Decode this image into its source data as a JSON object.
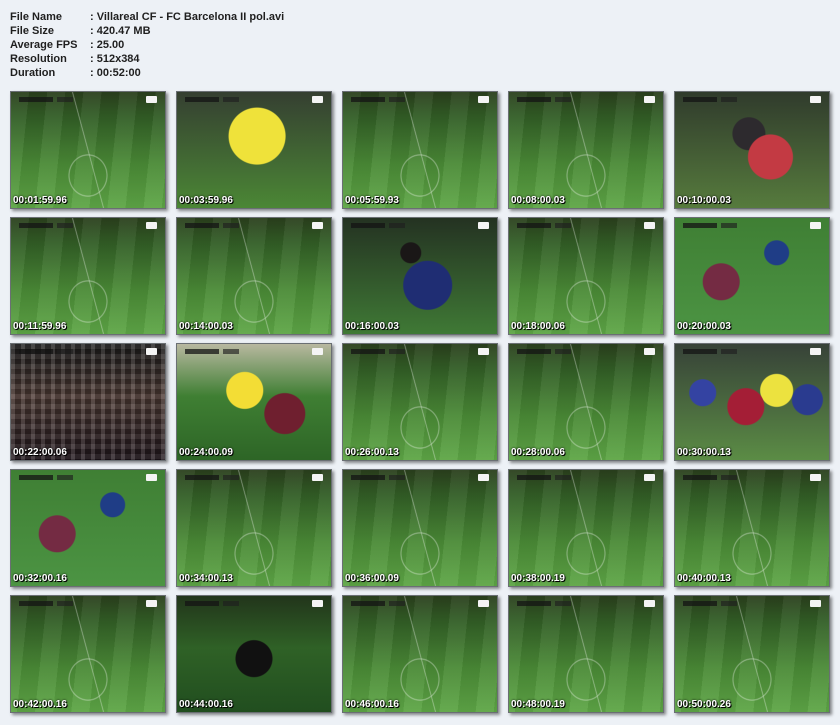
{
  "file_info": [
    {
      "label": "File Name",
      "value": ": Villareal CF - FC Barcelona II pol.avi"
    },
    {
      "label": "File Size",
      "value": ": 420.47 MB"
    },
    {
      "label": "Average FPS",
      "value": ": 25.00"
    },
    {
      "label": "Resolution",
      "value": ": 512x384"
    },
    {
      "label": "Duration",
      "value": ": 00:52:00"
    }
  ],
  "thumbnails": [
    {
      "time": "00:01:59.96",
      "kind": "field"
    },
    {
      "time": "00:03:59.96",
      "kind": "yellowplay"
    },
    {
      "time": "00:05:59.93",
      "kind": "field"
    },
    {
      "time": "00:08:00.03",
      "kind": "field"
    },
    {
      "time": "00:10:00.03",
      "kind": "close"
    },
    {
      "time": "00:11:59.96",
      "kind": "field"
    },
    {
      "time": "00:14:00.03",
      "kind": "field"
    },
    {
      "time": "00:16:00.03",
      "kind": "blueplayer"
    },
    {
      "time": "00:18:00.06",
      "kind": "field"
    },
    {
      "time": "00:20:00.03",
      "kind": "tackle"
    },
    {
      "time": "00:22:00.06",
      "kind": "crowd"
    },
    {
      "time": "00:24:00.09",
      "kind": "fall"
    },
    {
      "time": "00:26:00.13",
      "kind": "field"
    },
    {
      "time": "00:28:00.06",
      "kind": "field"
    },
    {
      "time": "00:30:00.13",
      "kind": "multi"
    },
    {
      "time": "00:32:00.16",
      "kind": "tackle"
    },
    {
      "time": "00:34:00.13",
      "kind": "field"
    },
    {
      "time": "00:36:00.09",
      "kind": "field"
    },
    {
      "time": "00:38:00.19",
      "kind": "field"
    },
    {
      "time": "00:40:00.13",
      "kind": "field"
    },
    {
      "time": "00:42:00.16",
      "kind": "field"
    },
    {
      "time": "00:44:00.16",
      "kind": "ref"
    },
    {
      "time": "00:46:00.16",
      "kind": "field"
    },
    {
      "time": "00:48:00.19",
      "kind": "field"
    },
    {
      "time": "00:50:00.26",
      "kind": "field"
    }
  ]
}
